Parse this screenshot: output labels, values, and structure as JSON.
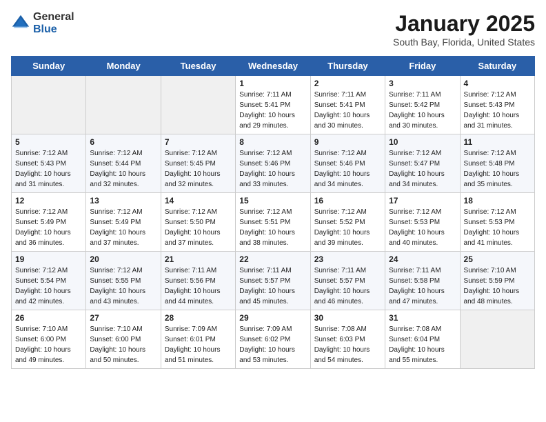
{
  "header": {
    "logo_general": "General",
    "logo_blue": "Blue",
    "title": "January 2025",
    "subtitle": "South Bay, Florida, United States"
  },
  "weekdays": [
    "Sunday",
    "Monday",
    "Tuesday",
    "Wednesday",
    "Thursday",
    "Friday",
    "Saturday"
  ],
  "weeks": [
    [
      {
        "day": "",
        "sunrise": "",
        "sunset": "",
        "daylight": "",
        "empty": true
      },
      {
        "day": "",
        "sunrise": "",
        "sunset": "",
        "daylight": "",
        "empty": true
      },
      {
        "day": "",
        "sunrise": "",
        "sunset": "",
        "daylight": "",
        "empty": true
      },
      {
        "day": "1",
        "sunrise": "7:11 AM",
        "sunset": "5:41 PM",
        "daylight": "10 hours and 29 minutes."
      },
      {
        "day": "2",
        "sunrise": "7:11 AM",
        "sunset": "5:41 PM",
        "daylight": "10 hours and 30 minutes."
      },
      {
        "day": "3",
        "sunrise": "7:11 AM",
        "sunset": "5:42 PM",
        "daylight": "10 hours and 30 minutes."
      },
      {
        "day": "4",
        "sunrise": "7:12 AM",
        "sunset": "5:43 PM",
        "daylight": "10 hours and 31 minutes."
      }
    ],
    [
      {
        "day": "5",
        "sunrise": "7:12 AM",
        "sunset": "5:43 PM",
        "daylight": "10 hours and 31 minutes."
      },
      {
        "day": "6",
        "sunrise": "7:12 AM",
        "sunset": "5:44 PM",
        "daylight": "10 hours and 32 minutes."
      },
      {
        "day": "7",
        "sunrise": "7:12 AM",
        "sunset": "5:45 PM",
        "daylight": "10 hours and 32 minutes."
      },
      {
        "day": "8",
        "sunrise": "7:12 AM",
        "sunset": "5:46 PM",
        "daylight": "10 hours and 33 minutes."
      },
      {
        "day": "9",
        "sunrise": "7:12 AM",
        "sunset": "5:46 PM",
        "daylight": "10 hours and 34 minutes."
      },
      {
        "day": "10",
        "sunrise": "7:12 AM",
        "sunset": "5:47 PM",
        "daylight": "10 hours and 34 minutes."
      },
      {
        "day": "11",
        "sunrise": "7:12 AM",
        "sunset": "5:48 PM",
        "daylight": "10 hours and 35 minutes."
      }
    ],
    [
      {
        "day": "12",
        "sunrise": "7:12 AM",
        "sunset": "5:49 PM",
        "daylight": "10 hours and 36 minutes."
      },
      {
        "day": "13",
        "sunrise": "7:12 AM",
        "sunset": "5:49 PM",
        "daylight": "10 hours and 37 minutes."
      },
      {
        "day": "14",
        "sunrise": "7:12 AM",
        "sunset": "5:50 PM",
        "daylight": "10 hours and 37 minutes."
      },
      {
        "day": "15",
        "sunrise": "7:12 AM",
        "sunset": "5:51 PM",
        "daylight": "10 hours and 38 minutes."
      },
      {
        "day": "16",
        "sunrise": "7:12 AM",
        "sunset": "5:52 PM",
        "daylight": "10 hours and 39 minutes."
      },
      {
        "day": "17",
        "sunrise": "7:12 AM",
        "sunset": "5:53 PM",
        "daylight": "10 hours and 40 minutes."
      },
      {
        "day": "18",
        "sunrise": "7:12 AM",
        "sunset": "5:53 PM",
        "daylight": "10 hours and 41 minutes."
      }
    ],
    [
      {
        "day": "19",
        "sunrise": "7:12 AM",
        "sunset": "5:54 PM",
        "daylight": "10 hours and 42 minutes."
      },
      {
        "day": "20",
        "sunrise": "7:12 AM",
        "sunset": "5:55 PM",
        "daylight": "10 hours and 43 minutes."
      },
      {
        "day": "21",
        "sunrise": "7:11 AM",
        "sunset": "5:56 PM",
        "daylight": "10 hours and 44 minutes."
      },
      {
        "day": "22",
        "sunrise": "7:11 AM",
        "sunset": "5:57 PM",
        "daylight": "10 hours and 45 minutes."
      },
      {
        "day": "23",
        "sunrise": "7:11 AM",
        "sunset": "5:57 PM",
        "daylight": "10 hours and 46 minutes."
      },
      {
        "day": "24",
        "sunrise": "7:11 AM",
        "sunset": "5:58 PM",
        "daylight": "10 hours and 47 minutes."
      },
      {
        "day": "25",
        "sunrise": "7:10 AM",
        "sunset": "5:59 PM",
        "daylight": "10 hours and 48 minutes."
      }
    ],
    [
      {
        "day": "26",
        "sunrise": "7:10 AM",
        "sunset": "6:00 PM",
        "daylight": "10 hours and 49 minutes."
      },
      {
        "day": "27",
        "sunrise": "7:10 AM",
        "sunset": "6:00 PM",
        "daylight": "10 hours and 50 minutes."
      },
      {
        "day": "28",
        "sunrise": "7:09 AM",
        "sunset": "6:01 PM",
        "daylight": "10 hours and 51 minutes."
      },
      {
        "day": "29",
        "sunrise": "7:09 AM",
        "sunset": "6:02 PM",
        "daylight": "10 hours and 53 minutes."
      },
      {
        "day": "30",
        "sunrise": "7:08 AM",
        "sunset": "6:03 PM",
        "daylight": "10 hours and 54 minutes."
      },
      {
        "day": "31",
        "sunrise": "7:08 AM",
        "sunset": "6:04 PM",
        "daylight": "10 hours and 55 minutes."
      },
      {
        "day": "",
        "sunrise": "",
        "sunset": "",
        "daylight": "",
        "empty": true
      }
    ]
  ],
  "labels": {
    "sunrise_prefix": "Sunrise: ",
    "sunset_prefix": "Sunset: ",
    "daylight_prefix": "Daylight: "
  }
}
